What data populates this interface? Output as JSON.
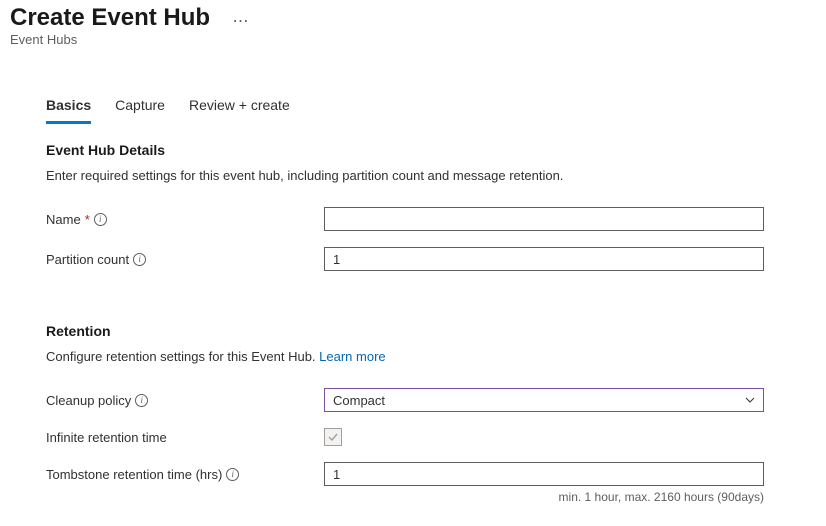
{
  "header": {
    "title": "Create Event Hub",
    "subtitle": "Event Hubs"
  },
  "tabs": {
    "items": [
      {
        "label": "Basics",
        "active": true
      },
      {
        "label": "Capture",
        "active": false
      },
      {
        "label": "Review + create",
        "active": false
      }
    ]
  },
  "sections": {
    "details": {
      "heading": "Event Hub Details",
      "description": "Enter required settings for this event hub, including partition count and message retention.",
      "fields": {
        "name": {
          "label": "Name",
          "value": ""
        },
        "partition_count": {
          "label": "Partition count",
          "value": "1"
        }
      }
    },
    "retention": {
      "heading": "Retention",
      "description_prefix": "Configure retention settings for this Event Hub. ",
      "learn_more": "Learn more",
      "fields": {
        "cleanup_policy": {
          "label": "Cleanup policy",
          "value": "Compact"
        },
        "infinite_retention": {
          "label": "Infinite retention time",
          "checked": true,
          "disabled": true
        },
        "tombstone_retention": {
          "label": "Tombstone retention time (hrs)",
          "value": "1",
          "hint": "min. 1 hour, max. 2160 hours (90days)"
        }
      }
    }
  }
}
